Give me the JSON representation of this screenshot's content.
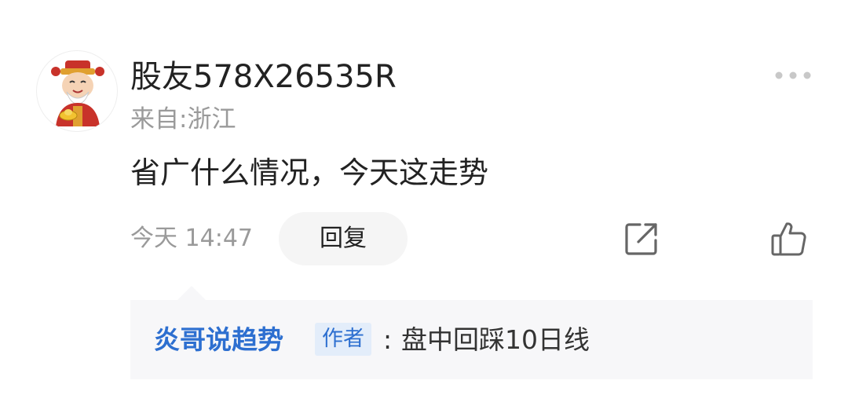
{
  "comment": {
    "username": "股友578X26535R",
    "location": "来自:浙江",
    "body": "省广什么情况，今天这走势",
    "time": "今天 14:47",
    "reply_label": "回复",
    "icons": {
      "avatar": "caishen-avatar",
      "more": "more-dots-icon",
      "share": "share-icon",
      "like": "thumbs-up-icon"
    }
  },
  "reply": {
    "author": "炎哥说趋势",
    "badge": "作者",
    "separator": ":",
    "text": "盘中回踩10日线"
  },
  "colors": {
    "accent_blue": "#2d6fd0",
    "badge_bg": "#e3edfa",
    "muted_text": "#9a9a9a",
    "reply_bg": "#f7f7f9"
  }
}
